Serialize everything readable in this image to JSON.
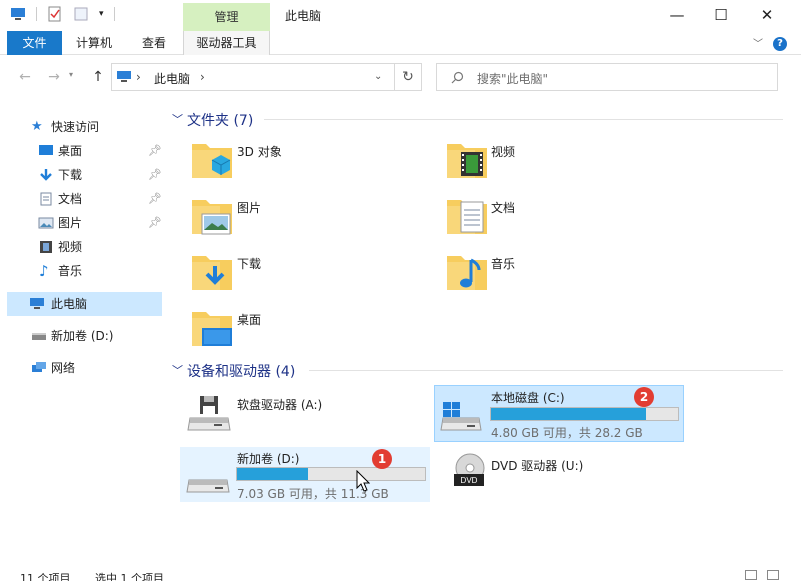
{
  "titlebar": {
    "manage_tab": "管理",
    "title": "此电脑",
    "minimize": "—",
    "maximize": "☐",
    "close": "✕"
  },
  "ribbon": {
    "file": "文件",
    "tabs": [
      "计算机",
      "查看",
      "驱动器工具"
    ],
    "help": "?"
  },
  "nav": {
    "back": "←",
    "forward": "→",
    "up": "↑",
    "refresh": "↻",
    "address_text": "此电脑",
    "address_sep": "›",
    "search_placeholder": "搜索\"此电脑\""
  },
  "sidebar": {
    "quick_access": "快速访问",
    "items": [
      {
        "label": "桌面",
        "icon": "desktop-icon",
        "pinned": true
      },
      {
        "label": "下载",
        "icon": "download-icon",
        "pinned": true
      },
      {
        "label": "文档",
        "icon": "document-icon",
        "pinned": true
      },
      {
        "label": "图片",
        "icon": "picture-icon",
        "pinned": true
      },
      {
        "label": "视频",
        "icon": "video-icon",
        "pinned": false
      },
      {
        "label": "音乐",
        "icon": "music-icon",
        "pinned": false
      }
    ],
    "this_pc": "此电脑",
    "new_volume": "新加卷 (D:)",
    "network": "网络"
  },
  "folders_group": {
    "title": "文件夹 (7)",
    "items": [
      "3D 对象",
      "视频",
      "图片",
      "文档",
      "下载",
      "音乐",
      "桌面"
    ]
  },
  "drives_group": {
    "title": "设备和驱动器 (4)",
    "floppy": "软盘驱动器 (A:)",
    "c_drive": {
      "name": "本地磁盘 (C:)",
      "sub": "4.80 GB 可用，共 28.2 GB",
      "used_fraction": 0.83,
      "badge": "2"
    },
    "d_drive": {
      "name": "新加卷 (D:)",
      "sub": "7.03 GB 可用，共 11.3 GB",
      "used_fraction": 0.38,
      "badge": "1"
    },
    "dvd": "DVD 驱动器 (U:)"
  },
  "status": {
    "count": "11 个项目",
    "selected": "选中 1 个项目"
  },
  "colors": {
    "accent": "#1979ca",
    "bar_fill": "#26a0da",
    "badge": "#e23d32",
    "selection": "#cce8ff",
    "group_head": "#1e3287"
  }
}
